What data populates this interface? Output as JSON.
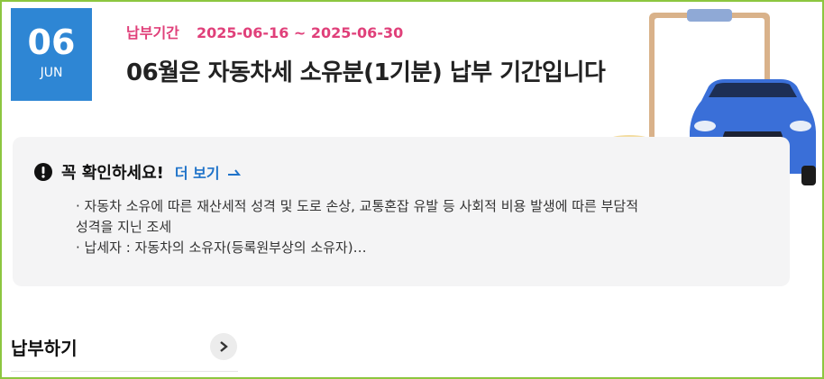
{
  "date_badge": {
    "day": "06",
    "month": "JUN"
  },
  "period": {
    "label": "납부기간",
    "range": "2025-06-16 ~ 2025-06-30"
  },
  "notice": {
    "title": "06월은 자동차세 소유분(1기분) 납부 기간입니다"
  },
  "info": {
    "title": "꼭 확인하세요!",
    "more_label": "더 보기",
    "lines": [
      "· 자동차 소유에 따른 재산세적 성격 및 도로 손상, 교통혼잡 유발 등 사회적 비용 발생에 따른 부담적",
      "성격을 지닌 조세",
      "· 납세자 : 자동차의 소유자(등록원부상의 소유자)…"
    ]
  },
  "pay": {
    "title": "납부하기"
  },
  "colors": {
    "accent_blue": "#2e86d4",
    "period_pink": "#e0407a",
    "link_blue": "#1f73c9",
    "frame_green": "#8cc63f",
    "car_blue": "#3a6fd8"
  },
  "icons": {
    "alert": "exclamation-circle-icon",
    "more": "arrow-right-icon",
    "pay": "chevron-right-icon",
    "illustration": "clipboard-car-coins-illustration"
  }
}
